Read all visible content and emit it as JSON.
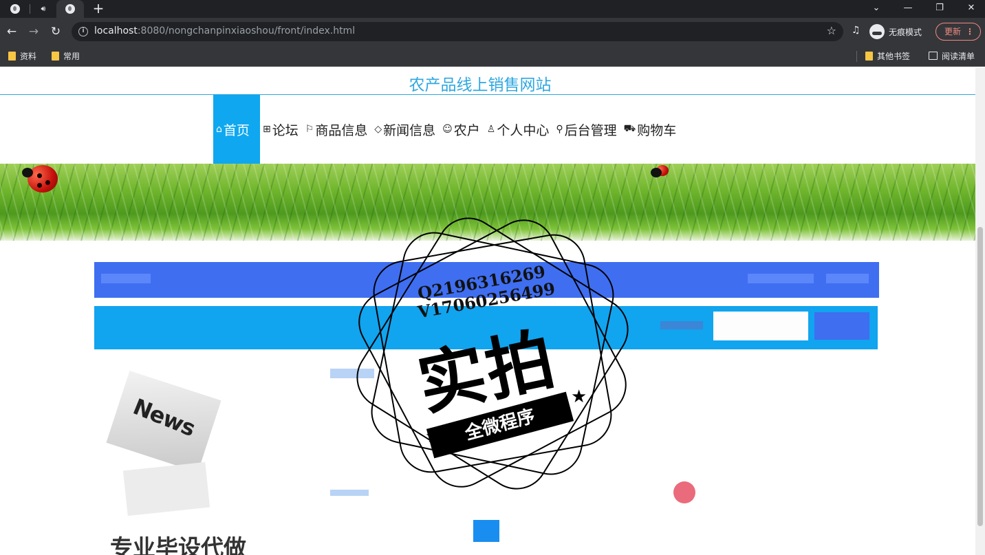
{
  "browser": {
    "new_tab_symbol": "+",
    "window_controls": {
      "dropdown": "⌄",
      "minimize": "—",
      "restore": "❐",
      "close": "✕"
    },
    "url_host": "localhost",
    "url_rest": ":8080/nongchanpinxiaoshou/front/index.html",
    "incognito_label": "无痕模式",
    "update_label": "更新",
    "update_menu": "⋮",
    "bookmarks": [
      "资料",
      "常用"
    ],
    "other_bookmarks": "其他书签",
    "reading_list": "阅读清单"
  },
  "site": {
    "title": "农产品线上销售网站",
    "nav": [
      {
        "label": "首页",
        "icon": "⌂",
        "active": true
      },
      {
        "label": "论坛",
        "icon": "⊞"
      },
      {
        "label": "商品信息",
        "icon": "⚐"
      },
      {
        "label": "新闻信息",
        "icon": "◇"
      },
      {
        "label": "农户",
        "icon": "☺"
      },
      {
        "label": "个人中心",
        "icon": "♙"
      },
      {
        "label": "后台管理",
        "icon": "⚲"
      },
      {
        "label": "购物车",
        "icon": "⛟"
      }
    ],
    "news_image_word": "News",
    "bottom_text": "专业毕设代做"
  },
  "watermark": {
    "qq": "Q2196316269",
    "wechat": "V17060256499",
    "headline": "实拍",
    "ribbon": "全微程序"
  },
  "colors": {
    "accent": "#2ea7e0",
    "nav_active": "#0fa8f0",
    "header_bar": "#3f6ef0",
    "search_bar": "#11a4ef"
  }
}
